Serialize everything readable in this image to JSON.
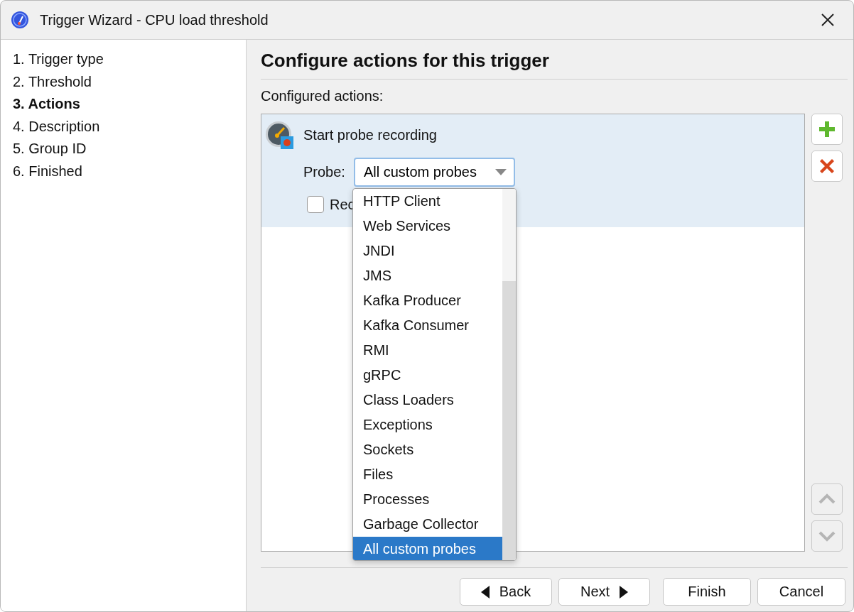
{
  "window": {
    "title": "Trigger Wizard - CPU load threshold"
  },
  "steps": [
    {
      "label": "1. Trigger type",
      "selected": false
    },
    {
      "label": "2. Threshold",
      "selected": false
    },
    {
      "label": "3. Actions",
      "selected": true
    },
    {
      "label": "4. Description",
      "selected": false
    },
    {
      "label": "5. Group ID",
      "selected": false
    },
    {
      "label": "6. Finished",
      "selected": false
    }
  ],
  "heading": "Configure actions for this trigger",
  "actions_label": "Configured actions:",
  "actions": [
    {
      "title": "Start probe recording",
      "selected": true,
      "probe_label": "Probe:",
      "probe_value": "All custom probes",
      "checkbox": {
        "label": "Rec",
        "checked": false
      }
    }
  ],
  "dropdown": {
    "open": true,
    "options": [
      {
        "label": "HTTP Client",
        "selected": false
      },
      {
        "label": "Web Services",
        "selected": false
      },
      {
        "label": "JNDI",
        "selected": false
      },
      {
        "label": "JMS",
        "selected": false
      },
      {
        "label": "Kafka Producer",
        "selected": false
      },
      {
        "label": "Kafka Consumer",
        "selected": false
      },
      {
        "label": "RMI",
        "selected": false
      },
      {
        "label": "gRPC",
        "selected": false
      },
      {
        "label": "Class Loaders",
        "selected": false
      },
      {
        "label": "Exceptions",
        "selected": false
      },
      {
        "label": "Sockets",
        "selected": false
      },
      {
        "label": "Files",
        "selected": false
      },
      {
        "label": "Processes",
        "selected": false
      },
      {
        "label": "Garbage Collector",
        "selected": false
      },
      {
        "label": "All custom probes",
        "selected": true
      }
    ]
  },
  "side_buttons": [
    {
      "kind": "add",
      "disabled": false
    },
    {
      "kind": "remove",
      "disabled": false
    },
    {
      "kind": "up",
      "disabled": true
    },
    {
      "kind": "down",
      "disabled": true
    }
  ],
  "buttons": [
    {
      "label": "Back",
      "kind": "back"
    },
    {
      "label": "Next",
      "kind": "next"
    },
    {
      "label": "Finish",
      "kind": "plain"
    },
    {
      "label": "Cancel",
      "kind": "plain"
    }
  ]
}
